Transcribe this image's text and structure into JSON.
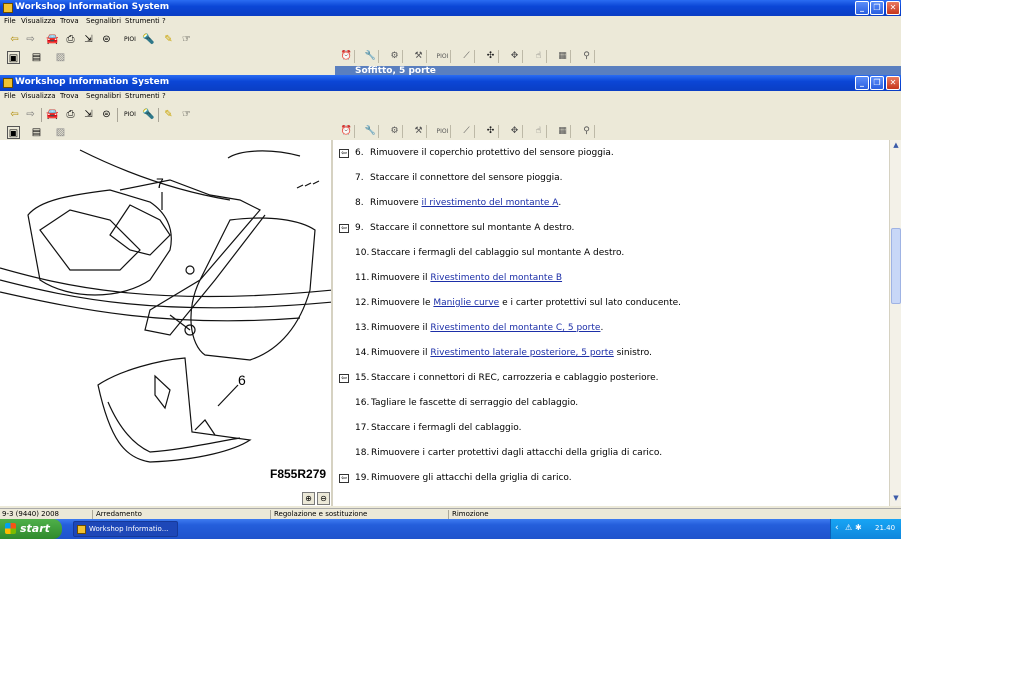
{
  "window": {
    "title": "Workshop Information System",
    "background_doc_title": "Soffitto, 5 porte"
  },
  "menu": [
    "File",
    "Visualizza",
    "Trova",
    "Segnalibri",
    "Strumenti",
    "?"
  ],
  "toolbar": {
    "pioi_label": "PIOI",
    "right_pioi_label": "PIOI"
  },
  "diagram": {
    "callout_7": "7",
    "callout_6": "6",
    "figure_code": "F855R279"
  },
  "steps": [
    {
      "num": "6.",
      "before": "Rimuovere il coperchio protettivo del sensore pioggia.",
      "link": "",
      "after": "",
      "icon": true
    },
    {
      "num": "7.",
      "before": "Staccare il connettore del sensore pioggia.",
      "link": "",
      "after": "",
      "icon": false
    },
    {
      "num": "8.",
      "before": "Rimuovere ",
      "link": "il rivestimento del montante A",
      "after": ".",
      "icon": false
    },
    {
      "num": "9.",
      "before": "Staccare il connettore sul montante A destro.",
      "link": "",
      "after": "",
      "icon": true
    },
    {
      "num": "10.",
      "before": "Staccare i fermagli del cablaggio sul montante A destro.",
      "link": "",
      "after": "",
      "icon": false
    },
    {
      "num": "11.",
      "before": "Rimuovere il ",
      "link": "Rivestimento del montante B",
      "after": "",
      "icon": false
    },
    {
      "num": "12.",
      "before": "Rimuovere le ",
      "link": "Maniglie curve",
      "after": " e i carter protettivi sul lato conducente.",
      "icon": false
    },
    {
      "num": "13.",
      "before": "Rimuovere il ",
      "link": "Rivestimento del montante C, 5 porte",
      "after": ".",
      "icon": false
    },
    {
      "num": "14.",
      "before": "Rimuovere il ",
      "link": "Rivestimento laterale posteriore, 5 porte",
      "after": " sinistro.",
      "icon": false
    },
    {
      "num": "15.",
      "before": "Staccare i connettori di REC, carrozzeria e cablaggio posteriore.",
      "link": "",
      "after": "",
      "icon": true
    },
    {
      "num": "16.",
      "before": "Tagliare le fascette di serraggio del cablaggio.",
      "link": "",
      "after": "",
      "icon": false
    },
    {
      "num": "17.",
      "before": "Staccare i fermagli del cablaggio.",
      "link": "",
      "after": "",
      "icon": false
    },
    {
      "num": "18.",
      "before": "Rimuovere i carter protettivi dagli attacchi della griglia di carico.",
      "link": "",
      "after": "",
      "icon": false
    },
    {
      "num": "19.",
      "before": "Rimuovere gli attacchi della griglia di carico.",
      "link": "",
      "after": "",
      "icon": true
    }
  ],
  "status": {
    "model": "9-3 (9440) 2008",
    "section": "Arredamento",
    "group": "Regolazione e sostituzione",
    "operation": "Rimozione"
  },
  "taskbar": {
    "start_label": "start",
    "task_label": "Workshop Informatio...",
    "clock": "21.40"
  },
  "colors": {
    "titlebar": "#0b46d6",
    "taskbar": "#245edb",
    "start": "#3a9b35",
    "link": "#1d2fa8"
  }
}
